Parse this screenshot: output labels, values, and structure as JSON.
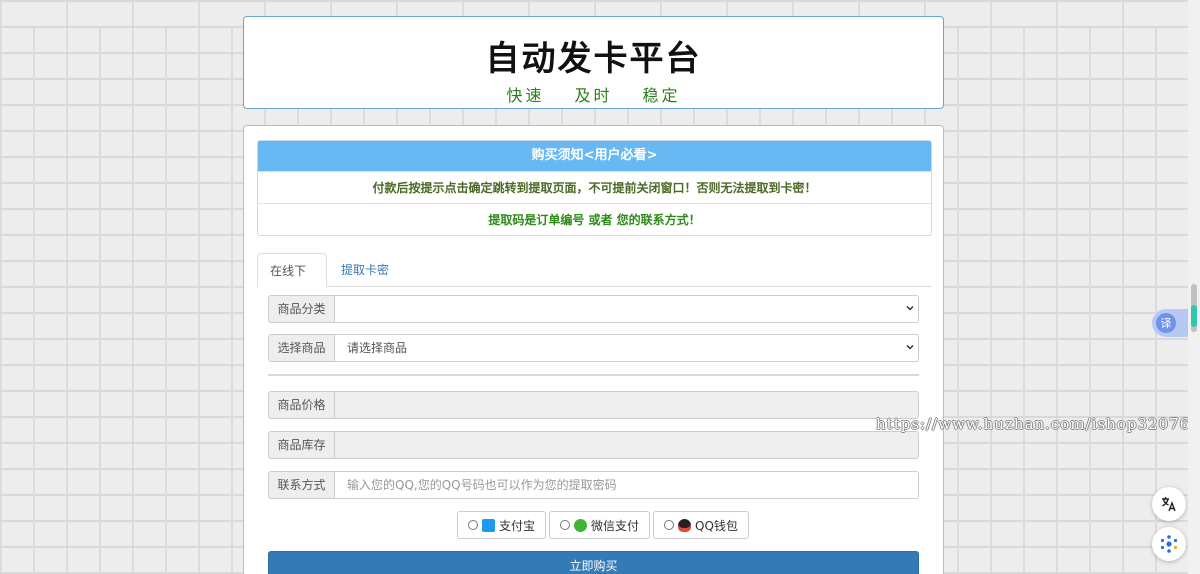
{
  "header": {
    "title": "自动发卡平台",
    "slogan": [
      "快速",
      "及时",
      "稳定"
    ]
  },
  "notice": {
    "heading": "购买须知<用户必看>",
    "line1": "付款后按提示点击确定跳转到提取页面，不可提前关闭窗口！否则无法提取到卡密！",
    "line2": "提取码是订单编号 或者 您的联系方式！"
  },
  "tabs": [
    {
      "label": "在线下单",
      "active": true
    },
    {
      "label": "提取卡密",
      "active": false
    }
  ],
  "form": {
    "category_label": "商品分类",
    "category_value": "",
    "product_label": "选择商品",
    "product_value": "请选择商品",
    "price_label": "商品价格",
    "price_value": "",
    "stock_label": "商品库存",
    "stock_value": "",
    "contact_label": "联系方式",
    "contact_placeholder": "输入您的QQ,您的QQ号码也可以作为您的提取密码"
  },
  "payment": {
    "options": [
      {
        "label": "支付宝",
        "icon": "alipay-icon",
        "color": "#1a9bef"
      },
      {
        "label": "微信支付",
        "icon": "wechat-icon",
        "color": "#3fb536"
      },
      {
        "label": "QQ钱包",
        "icon": "qq-icon",
        "color": "#e24b3b"
      }
    ]
  },
  "buy_label": "立即购买",
  "watermark": "https://www.huzhan.com/ishop32076",
  "side": {
    "translate_label": "译"
  },
  "colors": {
    "notice_head": "#68b9f3",
    "primary_button": "#337ab7",
    "slogan": "#2e7d1e"
  }
}
